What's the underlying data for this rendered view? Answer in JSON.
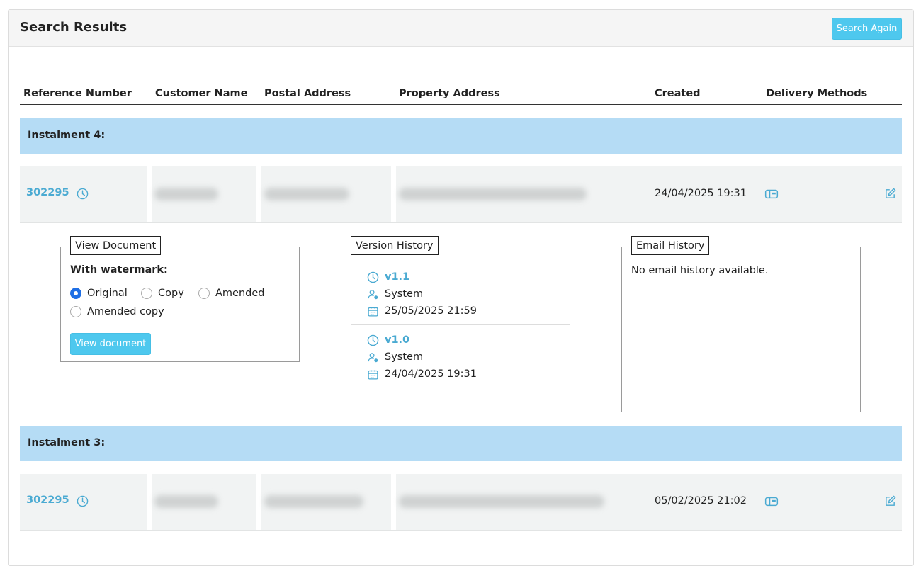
{
  "header": {
    "title": "Search Results",
    "search_again_label": "Search Again"
  },
  "columns": [
    "Reference Number",
    "Customer Name",
    "Postal Address",
    "Property Address",
    "Created",
    "Delivery Methods"
  ],
  "groups": [
    {
      "label": "Instalment 4:",
      "row": {
        "reference": "302295",
        "created": "24/04/2025 19:31"
      },
      "expanded": {
        "view_document": {
          "legend": "View Document",
          "watermark_label": "With watermark:",
          "options": [
            "Original",
            "Copy",
            "Amended",
            "Amended copy"
          ],
          "selected": "Original",
          "button_label": "View document"
        },
        "version_history": {
          "legend": "Version History",
          "versions": [
            {
              "version": "v1.1",
              "user": "System",
              "date": "25/05/2025 21:59"
            },
            {
              "version": "v1.0",
              "user": "System",
              "date": "24/04/2025 19:31"
            }
          ]
        },
        "email_history": {
          "legend": "Email History",
          "empty_text": "No email history available."
        }
      }
    },
    {
      "label": "Instalment 3:",
      "row": {
        "reference": "302295",
        "created": "05/02/2025 21:02"
      }
    }
  ],
  "icons": {
    "history": "clock-icon",
    "delivery": "mailbox-icon",
    "edit": "edit-icon",
    "user": "user-icon",
    "date": "calendar-icon"
  },
  "colors": {
    "accent": "#4aaad2",
    "button": "#4ec8ee",
    "group_bg": "#b5dcf5",
    "row_bg": "#f1f3f3",
    "radio_checked": "#1f6fe5"
  }
}
